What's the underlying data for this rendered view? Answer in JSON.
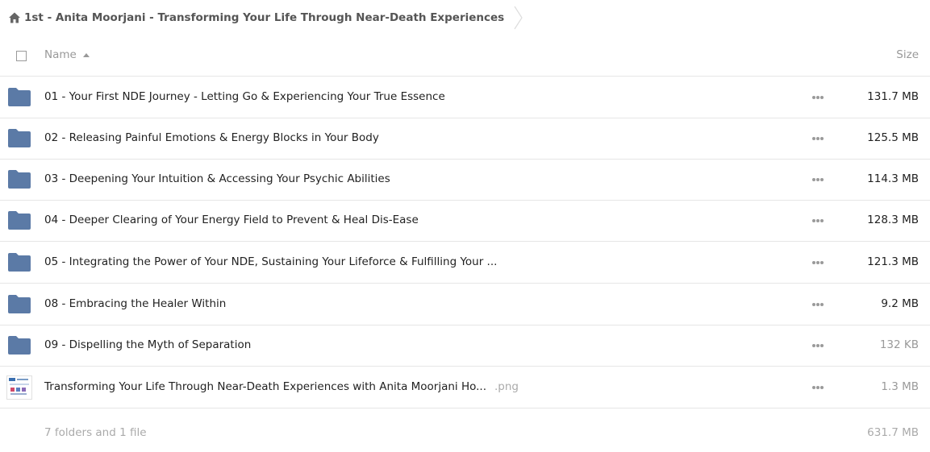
{
  "breadcrumb": {
    "title": "1st - Anita Moorjani - Transforming Your Life Through Near-Death Experiences"
  },
  "header": {
    "name_label": "Name",
    "size_label": "Size"
  },
  "items": [
    {
      "name": "01 - Your First NDE Journey - Letting Go & Experiencing Your True Essence",
      "size": "131.7 MB",
      "type": "folder"
    },
    {
      "name": "02 - Releasing Painful Emotions & Energy Blocks in Your Body",
      "size": "125.5 MB",
      "type": "folder"
    },
    {
      "name": "03 - Deepening Your Intuition & Accessing Your Psychic Abilities",
      "size": "114.3 MB",
      "type": "folder"
    },
    {
      "name": "04 - Deeper Clearing of Your Energy Field to Prevent & Heal Dis-Ease",
      "size": "128.3 MB",
      "type": "folder"
    },
    {
      "name": "05 - Integrating the Power of Your NDE, Sustaining Your Lifeforce & Fulfilling Your ...",
      "size": "121.3 MB",
      "type": "folder"
    },
    {
      "name": "08 - Embracing the Healer Within",
      "size": "9.2 MB",
      "type": "folder"
    },
    {
      "name": "09 - Dispelling the Myth of Separation",
      "size": "132 KB",
      "type": "folder"
    },
    {
      "name": "Transforming Your Life Through Near-Death Experiences with Anita Moorjani Ho...",
      "ext": ".png",
      "size": "1.3 MB",
      "type": "file"
    }
  ],
  "footer": {
    "summary": "7 folders and 1 file",
    "total": "631.7 MB"
  },
  "colors": {
    "folder": "#5b7aa6",
    "divider": "#e6e6e6",
    "muted_text": "#aaaaaa"
  },
  "icons": {
    "home": "home-icon",
    "folder": "folder-icon",
    "more": "more-dots-icon",
    "sort": "sort-ascending-icon"
  }
}
